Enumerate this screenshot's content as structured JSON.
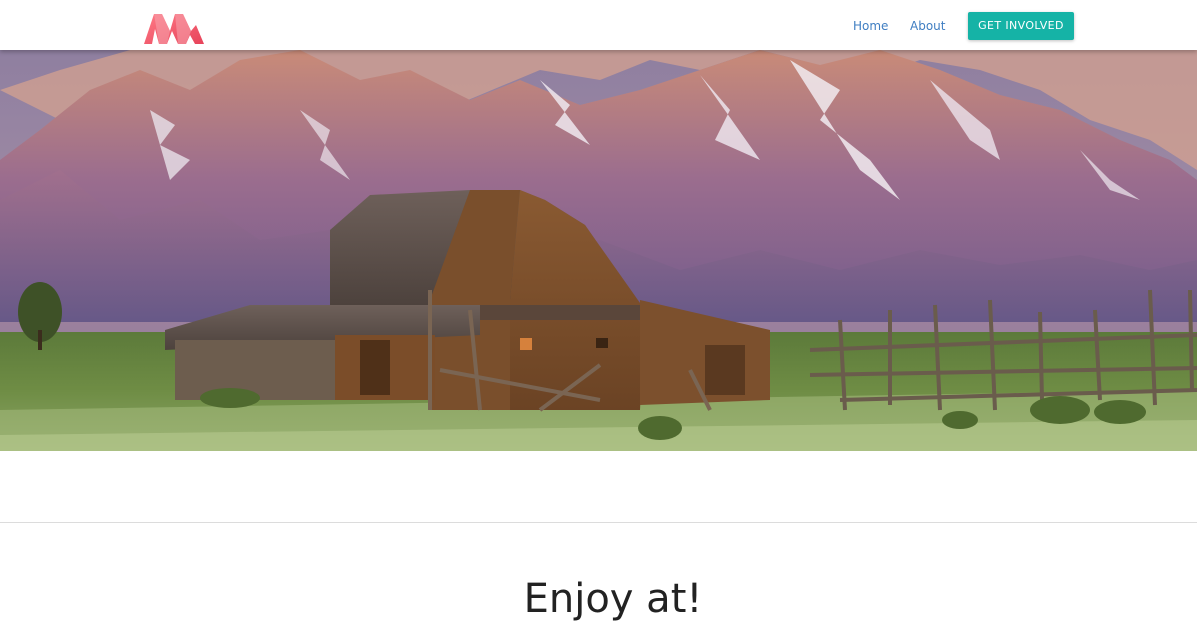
{
  "nav": {
    "logo_icon": "m-ribbon-logo-icon",
    "links": [
      "Home",
      "About"
    ],
    "cta_label": "GET INVOLVED"
  },
  "hero": {
    "image": "mountain-barn-landscape"
  },
  "main": {
    "headline": "Enjoy at!"
  },
  "colors": {
    "link": "#3f7ec2",
    "cta": "#15b3a6",
    "logo": "#f2596d"
  }
}
